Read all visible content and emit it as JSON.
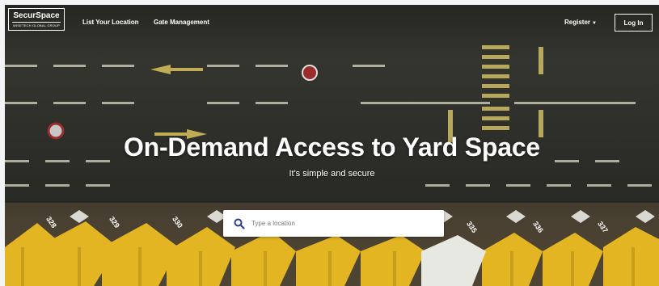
{
  "brand": {
    "name": "SecurSpace",
    "tagline": "WISETECH GLOBAL GROUP"
  },
  "nav": {
    "links": [
      "List Your Location",
      "Gate Management"
    ],
    "register_label": "Register",
    "login_label": "Log In"
  },
  "hero": {
    "title": "On-Demand Access to Yard Space",
    "subtitle": "It's simple and secure"
  },
  "search": {
    "placeholder": "Type a location"
  },
  "containers": [
    "328",
    "329",
    "330",
    "335",
    "336",
    "337"
  ],
  "colors": {
    "container_yellow": "#e3b522",
    "road_marking": "#d9d7c5",
    "accent_blue": "#2f3d8f"
  }
}
